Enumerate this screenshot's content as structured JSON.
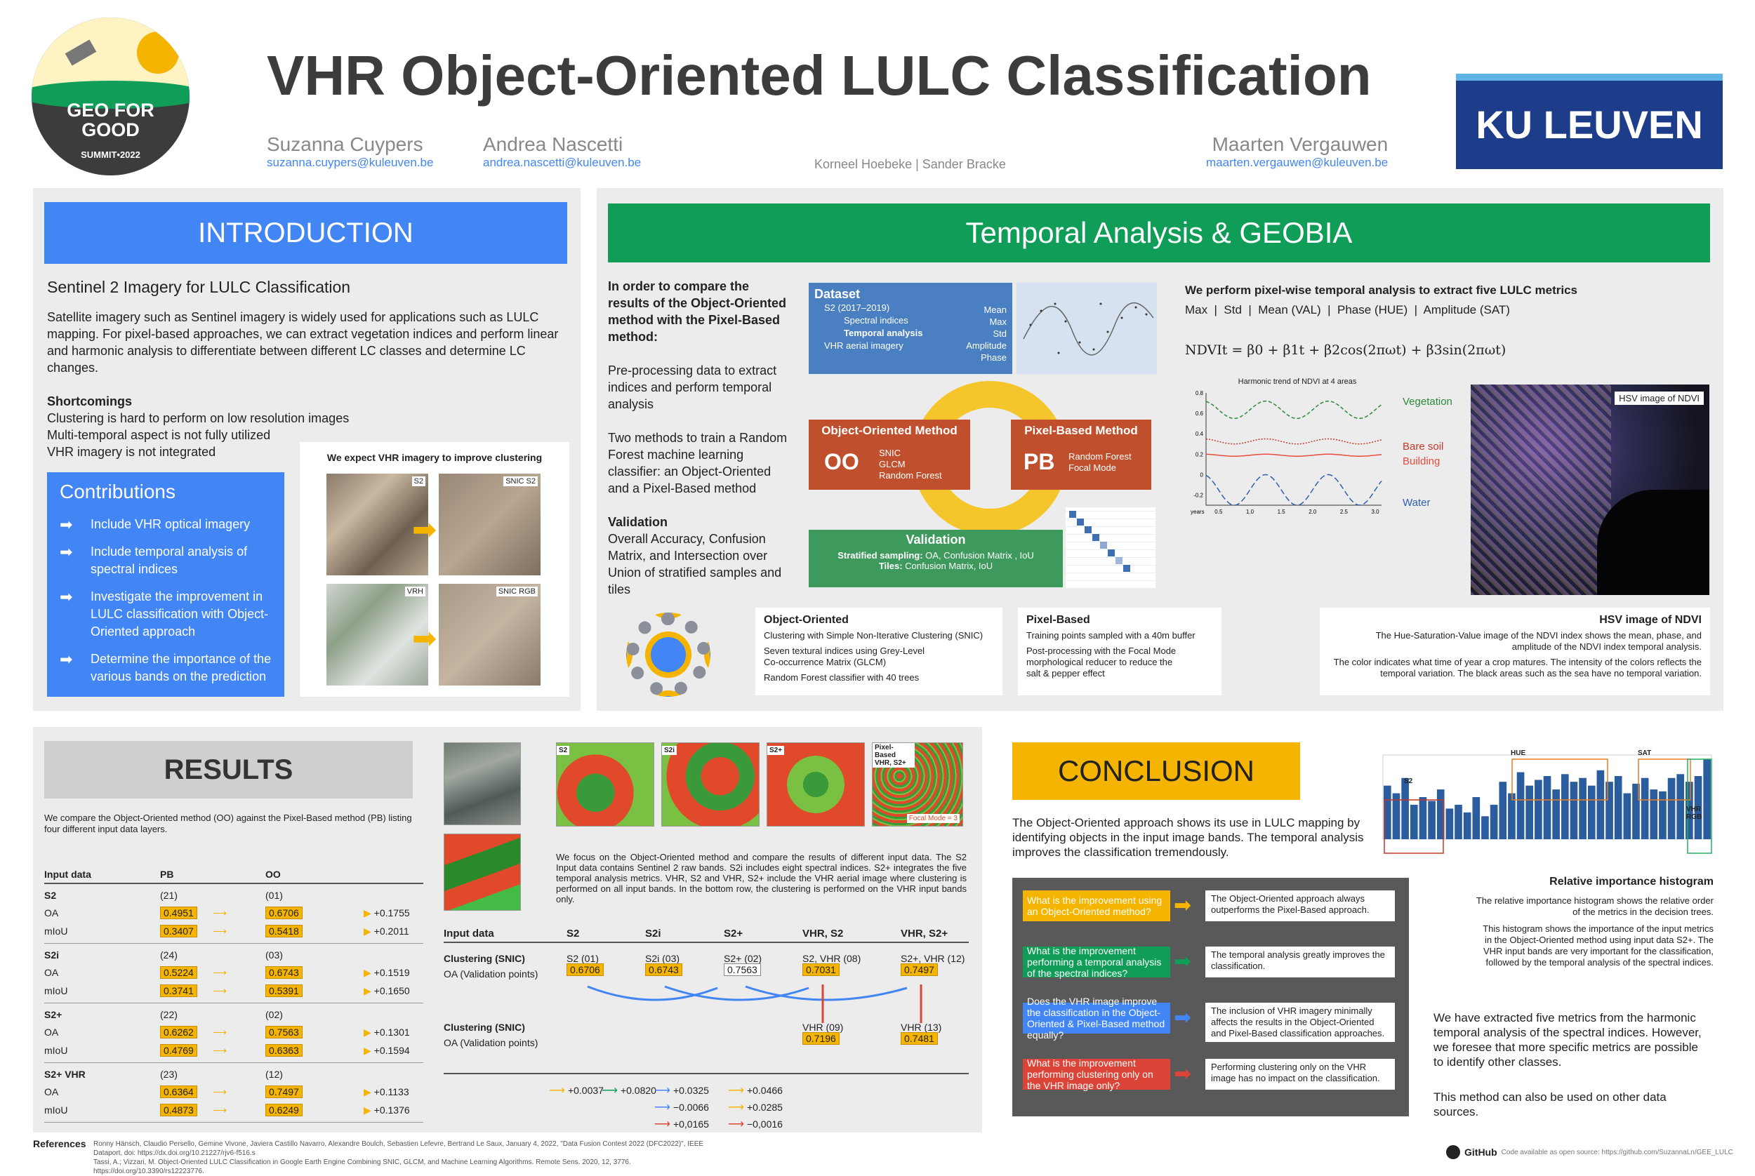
{
  "header": {
    "title": "VHR Object-Oriented LULC Classification",
    "logo_text": [
      "GEO FOR",
      "GOOD"
    ],
    "logo_sub": "SUMMIT•2022",
    "authors": [
      {
        "name": "Suzanna Cuypers",
        "email": "suzanna.cuypers@kuleuven.be"
      },
      {
        "name": "Andrea Nascetti",
        "email": "andrea.nascetti@kuleuven.be"
      },
      {
        "name": "Maarten Vergauwen",
        "email": "maarten.vergauwen@kuleuven.be"
      }
    ],
    "coauthors": "Korneel Hoebeke | Sander Bracke",
    "ku": "KU LEUVEN"
  },
  "intro": {
    "heading": "INTRODUCTION",
    "subtitle": "Sentinel 2 Imagery for LULC Classification",
    "para": "Satellite imagery such as Sentinel imagery is widely used for applications such as LULC mapping. For pixel-based approaches, we can extract vegetation indices and perform linear and harmonic analysis to differentiate between different LC classes and determine LC changes.",
    "short_title": "Shortcomings",
    "short": [
      "Clustering is hard to perform on low resolution images",
      "Multi-temporal aspect is not fully utilized",
      "VHR imagery is not integrated"
    ],
    "contrib_title": "Contributions",
    "contrib": [
      "Include VHR optical imagery",
      "Include temporal analysis of spectral indices",
      "Investigate the improvement in LULC classification with Object-Oriented approach",
      "Determine the importance of the various bands on the prediction"
    ],
    "fig_title": "We expect VHR imagery to improve clustering",
    "fig_labels": [
      "S2",
      "SNIC S2",
      "VRH",
      "SNIC RGB"
    ]
  },
  "temporal": {
    "heading": "Temporal Analysis & GEOBIA",
    "left": [
      "In order to compare the results of the Object-Oriented method with the Pixel-Based method:",
      "Pre-processing data to extract indices and perform temporal analysis",
      "Two methods to train a Random Forest machine learning classifier: an Object-Oriented and a Pixel-Based method"
    ],
    "val_title": "Validation",
    "val_text": "Overall Accuracy, Confusion Matrix, and Intersection over Union of stratified samples and tiles",
    "dataset": {
      "title": "Dataset",
      "items": [
        "S2 (2017–2019)",
        "Spectral indices",
        "Temporal analysis",
        "VHR aerial imagery"
      ],
      "metrics": [
        "Mean",
        "Max",
        "Std",
        "Amplitude",
        "Phase"
      ]
    },
    "oo": {
      "title": "Object-Oriented Method",
      "abbr": "OO",
      "items": [
        "SNIC",
        "GLCM",
        "Random Forest"
      ]
    },
    "pb": {
      "title": "Pixel-Based Method",
      "abbr": "PB",
      "items": [
        "Random Forest",
        "Focal Mode"
      ]
    },
    "validation": {
      "title": "Validation",
      "l1a": "Stratified sampling:",
      "l1b": "OA, Confusion Matrix , IoU",
      "l2a": "Tiles:",
      "l2b": "Confusion Matrix, IoU"
    },
    "metrics_title": "We perform pixel-wise temporal analysis to extract five LULC metrics",
    "metrics": "Max  |  Std  |  Mean (VAL)  |  Phase (HUE)  |  Amplitude (SAT)",
    "formula": "NDVIt = β0 + β1t + β2cos(2πωt) + β3sin(2πωt)",
    "harmonic_title": "Harmonic trend of NDVI at 4 areas",
    "harmonic_legend": [
      "Vegetation",
      "Bare soil",
      "Building",
      "Water"
    ],
    "hsv_label": "HSV image of NDVI",
    "oo_box": {
      "title": "Object-Oriented",
      "items": [
        "Clustering with Simple Non-Iterative Clustering (SNIC)",
        "Seven textural indices using Grey-Level Co-occurrence Matrix (GLCM)",
        "Random Forest classifier with 40 trees"
      ]
    },
    "pb_box": {
      "title": "Pixel-Based",
      "items": [
        "Training points sampled with a 40m buffer",
        "Post-processing with the Focal Mode morphological reducer to reduce the salt & pepper effect"
      ]
    },
    "hsv_box": {
      "title": "HSV image of NDVI",
      "items": [
        "The Hue-Saturation-Value image of the NDVI index shows the mean, phase, and amplitude of the NDVI index temporal analysis.",
        "The color indicates what time of year a crop matures. The intensity of the colors reflects the temporal variation. The black areas such as the sea have no temporal variation."
      ]
    }
  },
  "results": {
    "heading": "RESULTS",
    "intro": "We compare the Object-Oriented method (OO) against the Pixel-Based method (PB) listing four different input data layers.",
    "cols": [
      "Input data",
      "PB",
      "OO"
    ],
    "groups": [
      {
        "name": "S2",
        "pb_n": "(21)",
        "oo_n": "(01)",
        "rows": [
          {
            "m": "OA",
            "pb": "0.4951",
            "oo": "0.6706",
            "d": "+0.1755"
          },
          {
            "m": "mIoU",
            "pb": "0.3407",
            "oo": "0.5418",
            "d": "+0.2011"
          }
        ]
      },
      {
        "name": "S2i",
        "pb_n": "(24)",
        "oo_n": "(03)",
        "rows": [
          {
            "m": "OA",
            "pb": "0.5224",
            "oo": "0.6743",
            "d": "+0.1519"
          },
          {
            "m": "mIoU",
            "pb": "0.3741",
            "oo": "0.5391",
            "d": "+0.1650"
          }
        ]
      },
      {
        "name": "S2+",
        "pb_n": "(22)",
        "oo_n": "(02)",
        "rows": [
          {
            "m": "OA",
            "pb": "0.6262",
            "oo": "0.7563",
            "d": "+0.1301"
          },
          {
            "m": "mIoU",
            "pb": "0.4769",
            "oo": "0.6363",
            "d": "+0.1594"
          }
        ]
      },
      {
        "name": "S2+ VHR",
        "pb_n": "(23)",
        "oo_n": "(12)",
        "rows": [
          {
            "m": "OA",
            "pb": "0.6364",
            "oo": "0.7497",
            "d": "+0.1133"
          },
          {
            "m": "mIoU",
            "pb": "0.4873",
            "oo": "0.6249",
            "d": "+0.1376"
          }
        ]
      }
    ],
    "map_labels": [
      "S2",
      "S2i",
      "S2+",
      "Pixel-Based VHR, S2+"
    ],
    "focal": "Focal Mode = 3",
    "focus": "We focus on the Object-Oriented method and compare the results of different input data. The S2 Input data contains Sentinel 2 raw bands. S2i includes eight spectral indices. S2+ integrates the five temporal analysis metrics. VHR, S2 and VHR, S2+ include the VHR aerial image where clustering is performed on all input bands. In the bottom row, the clustering is performed on the VHR input bands only.",
    "cmp_cols": [
      "Input data",
      "S2",
      "S2i",
      "S2+",
      "VHR, S2",
      "VHR, S2+"
    ],
    "cmp1_title": "Clustering (SNIC)",
    "cmp1_sub": "OA (Validation points)",
    "cmp1": [
      {
        "l": "S2 (01)",
        "v": "0.6706"
      },
      {
        "l": "S2i (03)",
        "v": "0.6743"
      },
      {
        "l": "S2+ (02)",
        "v": "0.7563"
      },
      {
        "l": "S2, VHR (08)",
        "v": "0.7031"
      },
      {
        "l": "S2+, VHR (12)",
        "v": "0.7497"
      }
    ],
    "cmp2_title": "Clustering (SNIC)",
    "cmp2_sub": "OA (Validation points)",
    "cmp2": [
      {
        "l": "VHR (09)",
        "v": "0.7196"
      },
      {
        "l": "VHR (13)",
        "v": "0.7481"
      }
    ],
    "deltas": [
      "+0.0037",
      "+0.0820",
      "+0.0325",
      "+0.0466",
      "−0.0066",
      "+0.0285",
      "+0,0165",
      "−0,0016"
    ]
  },
  "conclusion": {
    "heading": "CONCLUSION",
    "text": "The Object-Oriented approach shows its use in LULC mapping by identifying objects in the input image bands. The temporal analysis improves the classification tremendously.",
    "qa": [
      {
        "q": "What is the improvement using an Object-Oriented method?",
        "a": "The Object-Oriented approach always outperforms the Pixel-Based approach.",
        "c": "#f4b400"
      },
      {
        "q": "What is the improvement performing a temporal analysis of the spectral indices?",
        "a": "The temporal analysis greatly improves the classification.",
        "c": "#0f9d58"
      },
      {
        "q": "Does the VHR image improve the classification in the Object-Oriented & Pixel-Based method equally?",
        "a": "The inclusion of VHR imagery minimally affects the results in the Object-Oriented and Pixel-Based classification approaches.",
        "c": "#4285f4"
      },
      {
        "q": "What is the improvement performing clustering only on the VHR image only?",
        "a": "Performing clustering only on the VHR image has no impact on the classification.",
        "c": "#db4437"
      }
    ],
    "hist_title": "Relative importance histogram",
    "hist_labels": [
      "S2",
      "HUE",
      "SAT",
      "VHR RGB"
    ],
    "hist_text": [
      "The relative importance histogram shows the relative order of the metrics in the decision trees.",
      "This histogram shows the importance of the input metrics in the Object-Oriented method using input data S2+. The VHR input bands are very important for the classification, followed by the temporal analysis of the spectral indices."
    ],
    "final": [
      "We have extracted five metrics from the harmonic temporal analysis of the spectral indices. However, we foresee that more specific metrics are possible to identify other classes.",
      "This method can also be used on other data sources."
    ],
    "github": "GitHub",
    "github_note": "Code available as open source: https://github.com/SuzannaLn/GEE_LULC"
  },
  "refs": {
    "title": "References",
    "items": [
      "Ronny Hänsch, Claudio Persello, Gemine Vivone, Javiera Castillo Navarro, Alexandre Boulch, Sebastien Lefevre, Bertrand Le Saux, January 4, 2022, \"Data Fusion Contest 2022 (DFC2022)\", IEEE Dataport, doi: https://dx.doi.org/10.21227/rjv6-f516.s",
      "Tassi, A.; Vizzari, M. Object-Oriented LULC Classification in Google Earth Engine Combining SNIC, GLCM, and Machine Learning Algorithms. Remote Sens. 2020, 12, 3776. https://doi.org/10.3390/rs12223776."
    ]
  },
  "chart_data": [
    {
      "type": "line",
      "title": "Harmonic trend of NDVI at 4 areas",
      "xlabel": "years",
      "x": [
        0.5,
        1.0,
        1.5,
        2.0,
        2.5,
        3.0
      ],
      "ylim": [
        -0.3,
        0.8
      ],
      "series": [
        {
          "name": "Vegetation",
          "values": [
            0.55,
            0.72,
            0.55,
            0.72,
            0.55,
            0.72
          ]
        },
        {
          "name": "Bare soil",
          "values": [
            0.3,
            0.35,
            0.3,
            0.35,
            0.3,
            0.35
          ]
        },
        {
          "name": "Building",
          "values": [
            0.18,
            0.2,
            0.18,
            0.2,
            0.18,
            0.2
          ]
        },
        {
          "name": "Water",
          "values": [
            -0.3,
            0.0,
            -0.3,
            0.0,
            -0.3,
            0.0
          ]
        }
      ]
    },
    {
      "type": "bar",
      "title": "Relative importance histogram",
      "values": [
        140,
        120,
        160,
        90,
        110,
        100,
        130,
        80,
        90,
        70,
        110,
        60,
        90,
        150,
        120,
        175,
        140,
        155,
        165,
        130,
        170,
        150,
        160,
        140,
        180,
        150,
        165,
        120,
        145,
        160,
        130,
        125,
        160,
        170,
        150,
        165,
        210
      ]
    }
  ],
  "colors": {
    "blue": "#4285f4",
    "green": "#0f9d58",
    "yellow": "#f4b400",
    "red": "#db4437",
    "ku_blue": "#1d3c8a"
  }
}
